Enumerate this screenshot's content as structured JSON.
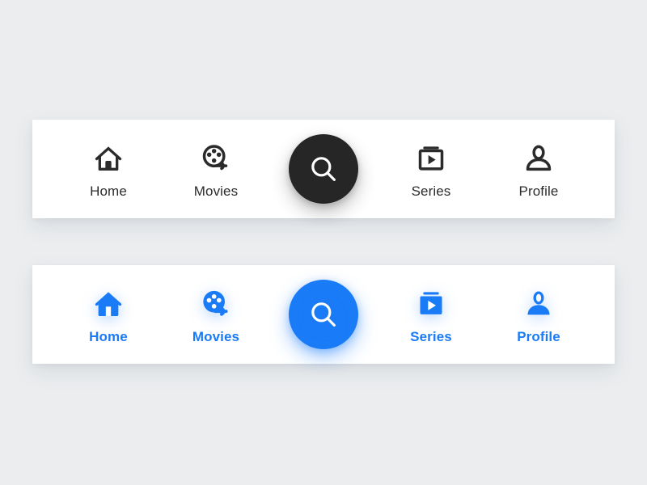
{
  "theme": {
    "page_background": "#ebedef",
    "bar_background": "#ffffff",
    "dark_accent": "#262626",
    "dark_label": "#2b2b2b",
    "blue_accent": "#1a7bf7",
    "icon_on_accent": "#ffffff"
  },
  "bars": [
    {
      "id": "inactive-bar",
      "style": "outline-dark",
      "items": [
        {
          "label": "Home",
          "icon": "home-icon"
        },
        {
          "label": "Movies",
          "icon": "film-reel-icon"
        },
        {
          "label": "",
          "icon": "search-icon"
        },
        {
          "label": "Series",
          "icon": "tv-play-icon"
        },
        {
          "label": "Profile",
          "icon": "person-icon"
        }
      ],
      "fab": {
        "icon": "search-icon",
        "background": "#262626"
      }
    },
    {
      "id": "active-bar",
      "style": "filled-blue",
      "items": [
        {
          "label": "Home",
          "icon": "home-icon"
        },
        {
          "label": "Movies",
          "icon": "film-reel-icon"
        },
        {
          "label": "",
          "icon": "search-icon"
        },
        {
          "label": "Series",
          "icon": "tv-play-icon"
        },
        {
          "label": "Profile",
          "icon": "person-icon"
        }
      ],
      "fab": {
        "icon": "search-icon",
        "background": "#1a7bf7"
      }
    }
  ]
}
